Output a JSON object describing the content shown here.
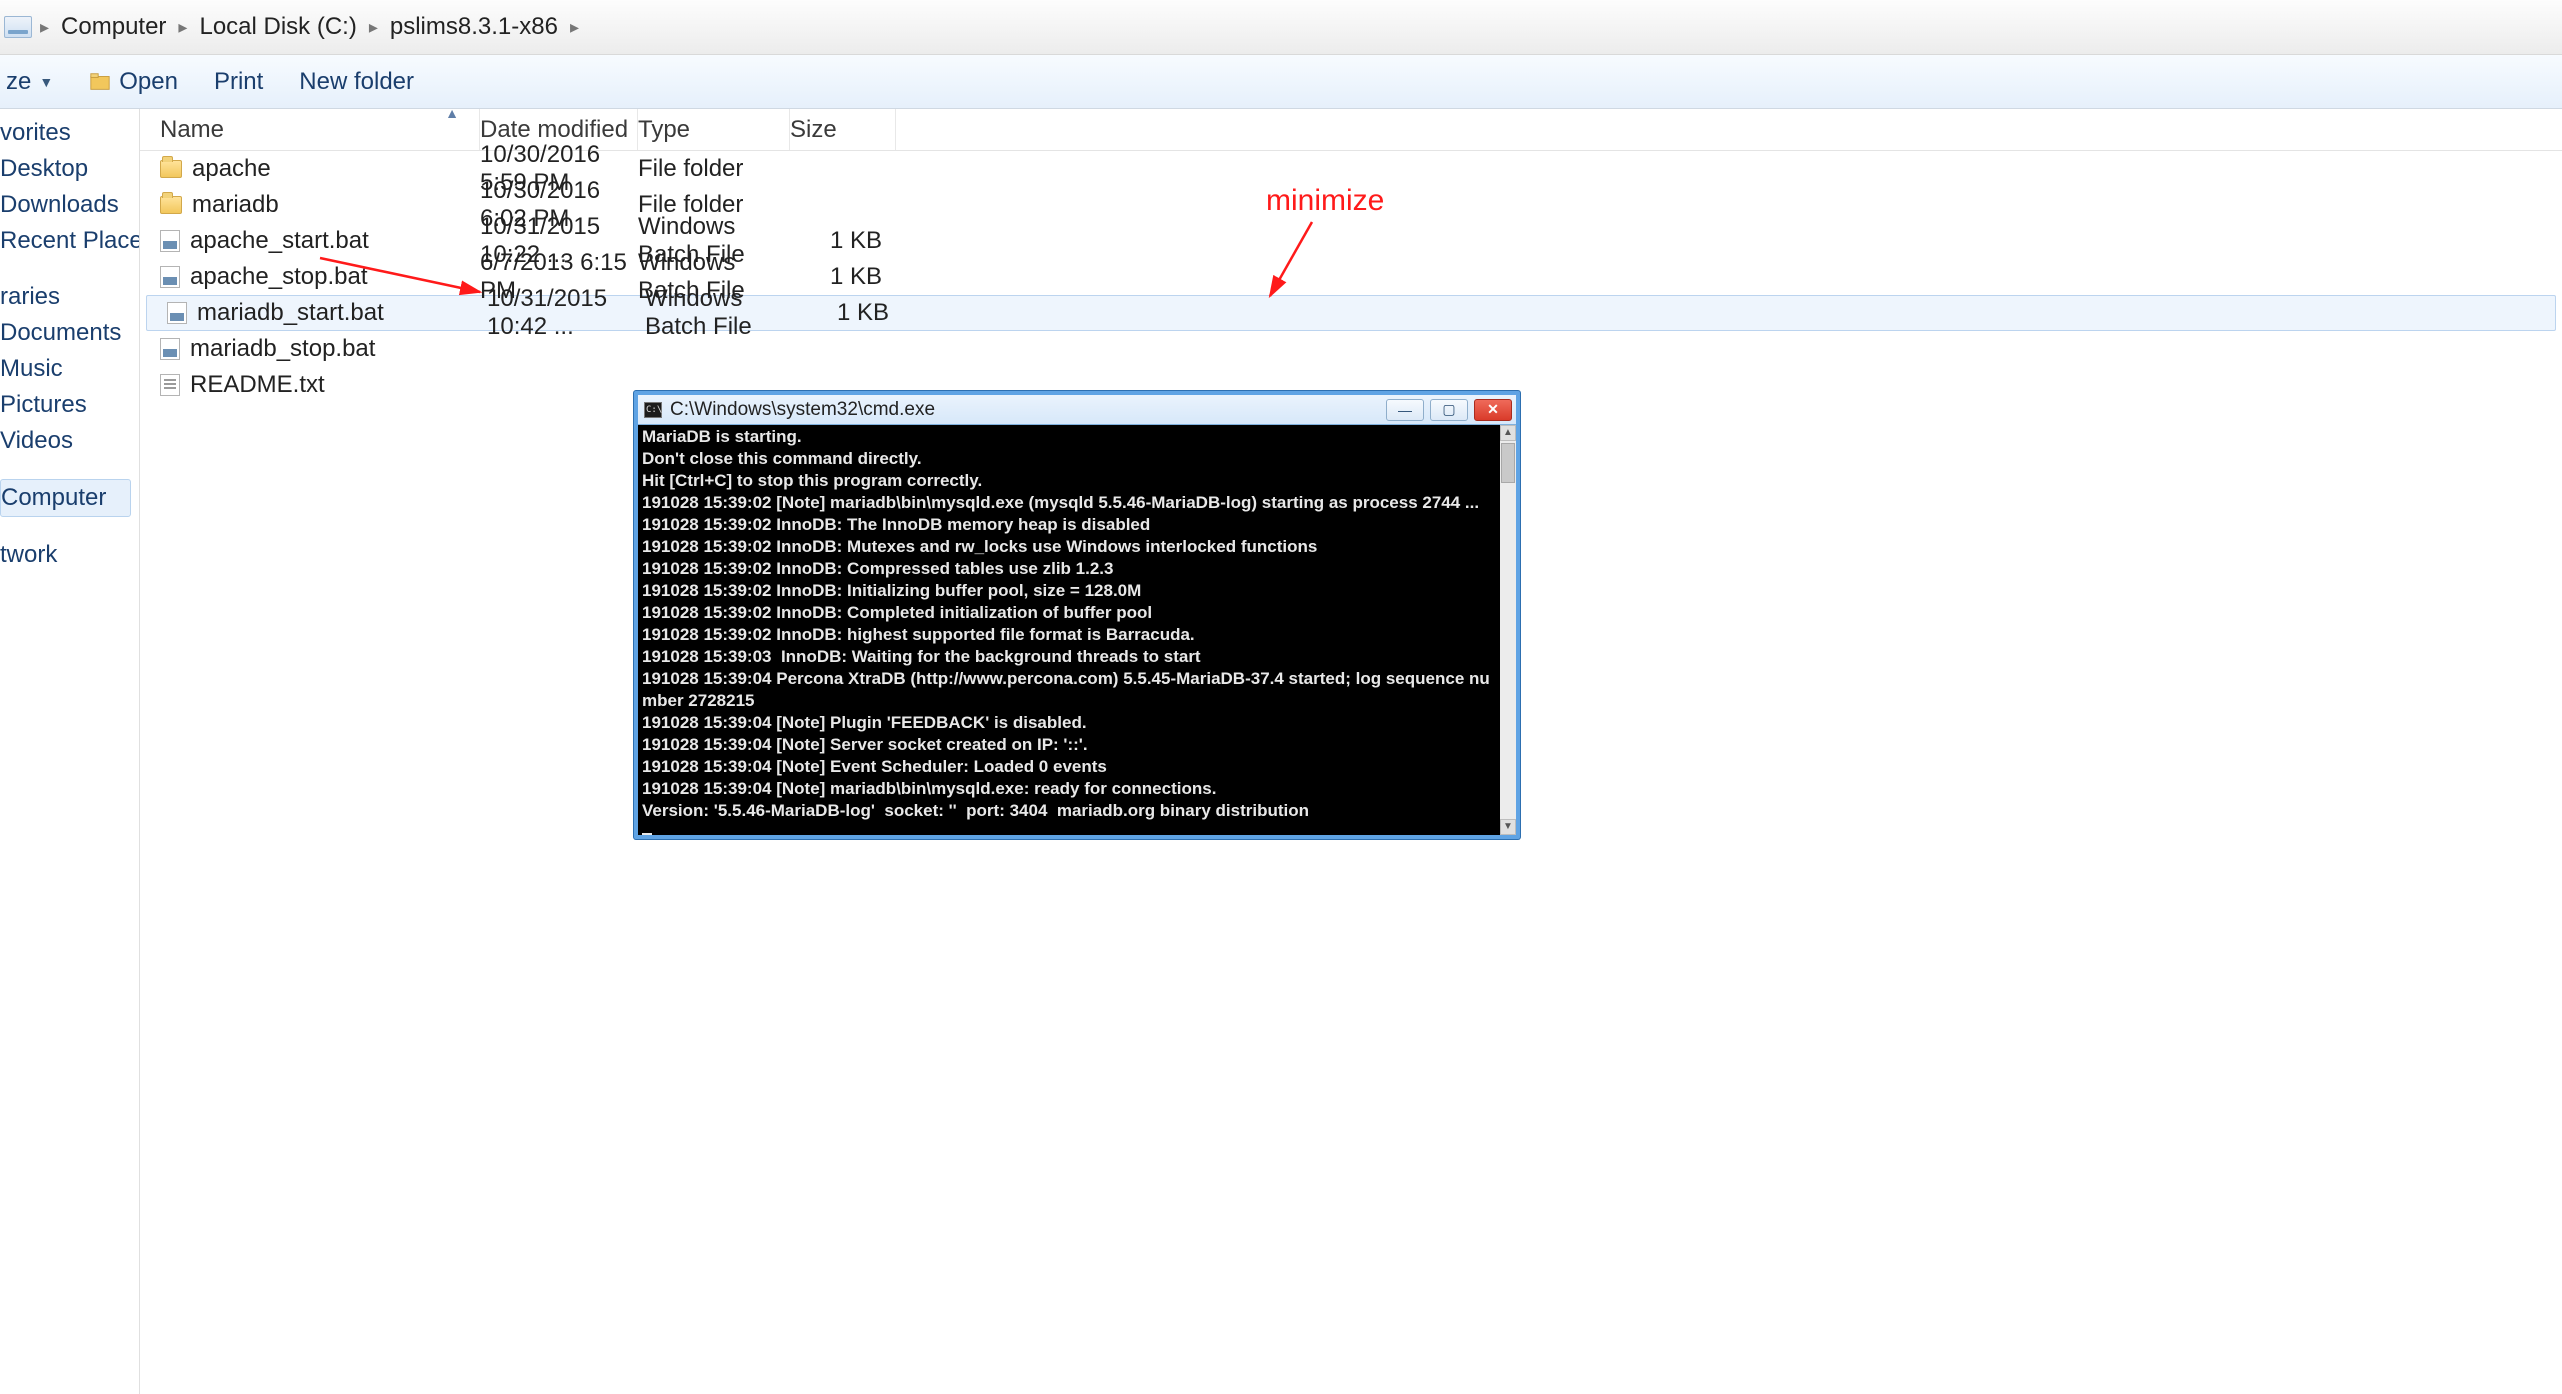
{
  "breadcrumb": [
    "Computer",
    "Local Disk (C:)",
    "pslims8.3.1-x86"
  ],
  "toolbar": {
    "organize": "ze",
    "open": "Open",
    "print": "Print",
    "new_folder": "New folder"
  },
  "sidebar": {
    "groups": [
      [
        "vorites",
        "Desktop",
        "Downloads",
        "Recent Places"
      ],
      [
        "raries",
        "Documents",
        "Music",
        "Pictures",
        "Videos"
      ],
      [
        "Computer"
      ],
      [
        "twork"
      ]
    ],
    "selected": "Computer"
  },
  "columns": {
    "name": "Name",
    "date": "Date modified",
    "type": "Type",
    "size": "Size"
  },
  "files": [
    {
      "icon": "folder",
      "name": "apache",
      "date": "10/30/2016 5:59 PM",
      "type": "File folder",
      "size": ""
    },
    {
      "icon": "folder",
      "name": "mariadb",
      "date": "10/30/2016 6:02 PM",
      "type": "File folder",
      "size": ""
    },
    {
      "icon": "bat",
      "name": "apache_start.bat",
      "date": "10/31/2015 10:22 ...",
      "type": "Windows Batch File",
      "size": "1 KB"
    },
    {
      "icon": "bat",
      "name": "apache_stop.bat",
      "date": "6/7/2013 6:15 PM",
      "type": "Windows Batch File",
      "size": "1 KB"
    },
    {
      "icon": "bat",
      "name": "mariadb_start.bat",
      "date": "10/31/2015 10:42 ...",
      "type": "Windows Batch File",
      "size": "1 KB",
      "selected": true
    },
    {
      "icon": "bat",
      "name": "mariadb_stop.bat",
      "date": "",
      "type": "",
      "size": ""
    },
    {
      "icon": "txt",
      "name": "README.txt",
      "date": "",
      "type": "",
      "size": ""
    }
  ],
  "cmd": {
    "title": "C:\\Windows\\system32\\cmd.exe",
    "lines": "MariaDB is starting.\nDon't close this command directly.\nHit [Ctrl+C] to stop this program correctly.\n191028 15:39:02 [Note] mariadb\\bin\\mysqld.exe (mysqld 5.5.46-MariaDB-log) starting as process 2744 ...\n191028 15:39:02 InnoDB: The InnoDB memory heap is disabled\n191028 15:39:02 InnoDB: Mutexes and rw_locks use Windows interlocked functions\n191028 15:39:02 InnoDB: Compressed tables use zlib 1.2.3\n191028 15:39:02 InnoDB: Initializing buffer pool, size = 128.0M\n191028 15:39:02 InnoDB: Completed initialization of buffer pool\n191028 15:39:02 InnoDB: highest supported file format is Barracuda.\n191028 15:39:03  InnoDB: Waiting for the background threads to start\n191028 15:39:04 Percona XtraDB (http://www.percona.com) 5.5.45-MariaDB-37.4 started; log sequence number 2728215\n191028 15:39:04 [Note] Plugin 'FEEDBACK' is disabled.\n191028 15:39:04 [Note] Server socket created on IP: '::'.\n191028 15:39:04 [Note] Event Scheduler: Loaded 0 events\n191028 15:39:04 [Note] mariadb\\bin\\mysqld.exe: ready for connections.\nVersion: '5.5.46-MariaDB-log'  socket: ''  port: 3404  mariadb.org binary distribution"
  },
  "annotation": {
    "minimize": "minimize"
  }
}
